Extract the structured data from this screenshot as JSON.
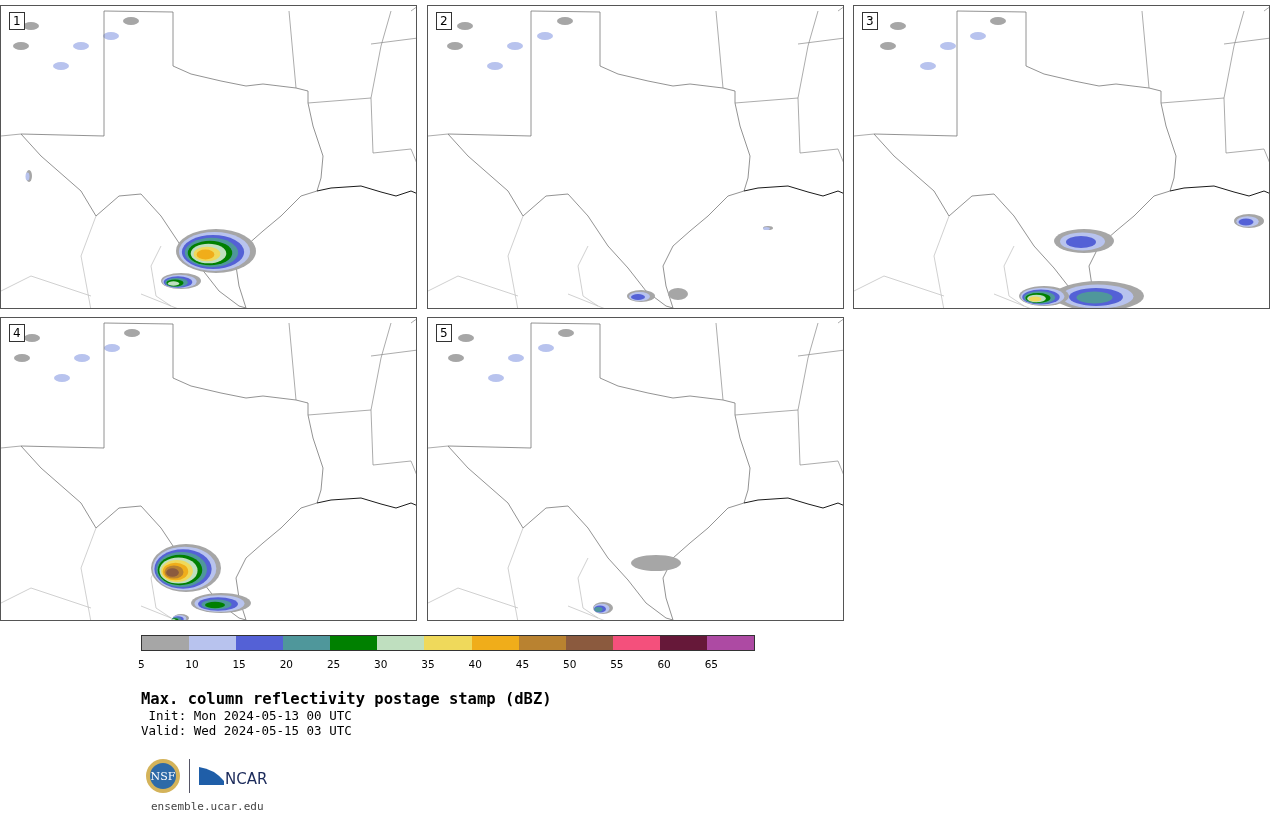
{
  "panels": [
    {
      "number": "1"
    },
    {
      "number": "2"
    },
    {
      "number": "3"
    },
    {
      "number": "4"
    },
    {
      "number": "5"
    }
  ],
  "colorbar": {
    "bins": [
      {
        "color": "#a6a6a6"
      },
      {
        "color": "#b8c3ee"
      },
      {
        "color": "#5461d6"
      },
      {
        "color": "#4f979b"
      },
      {
        "color": "#008000"
      },
      {
        "color": "#bfdfbf"
      },
      {
        "color": "#efd95b"
      },
      {
        "color": "#f0ad1a"
      },
      {
        "color": "#b98230"
      },
      {
        "color": "#8b5a3e"
      },
      {
        "color": "#f4507c"
      },
      {
        "color": "#661839"
      },
      {
        "color": "#ad4aa3"
      }
    ],
    "ticks": [
      "5",
      "10",
      "15",
      "20",
      "25",
      "30",
      "35",
      "40",
      "45",
      "50",
      "55",
      "60",
      "65"
    ]
  },
  "title": "Max. column reflectivity postage stamp (dBZ)",
  "init": " Init: Mon 2024-05-13 00 UTC",
  "valid": "Valid: Wed 2024-05-15 03 UTC",
  "logos": {
    "nsf": "NSF",
    "ncar": "NCAR"
  },
  "url": "ensemble.ucar.edu"
}
